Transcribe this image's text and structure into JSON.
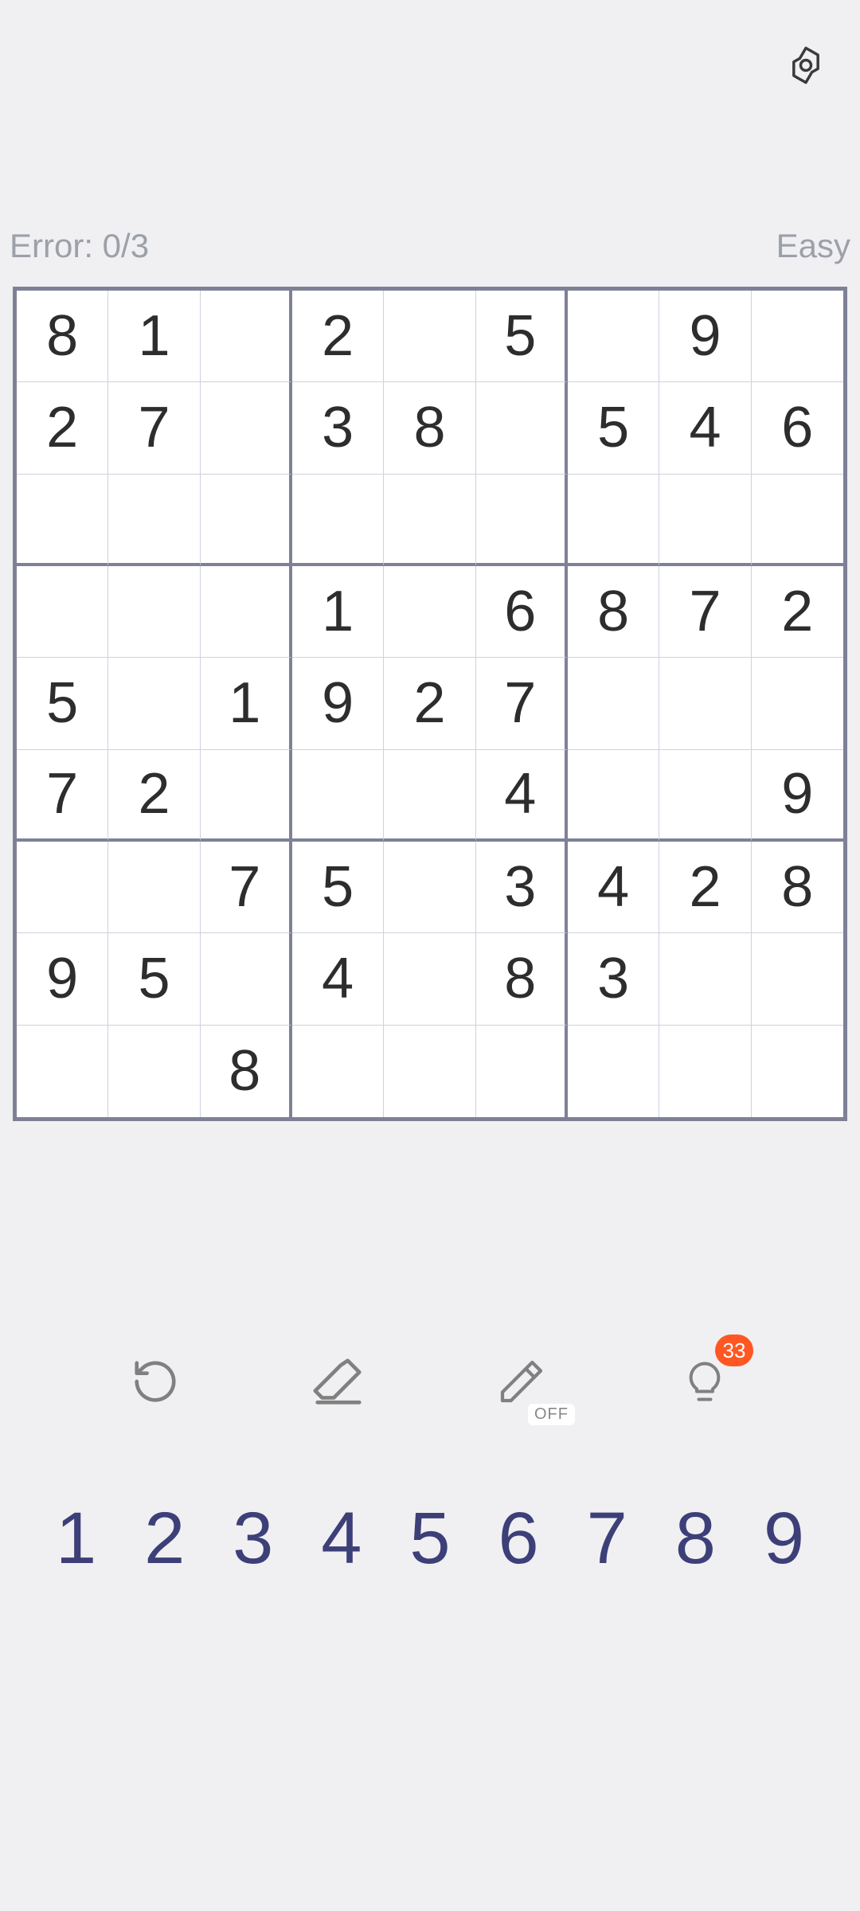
{
  "header": {
    "settings_icon": "settings"
  },
  "info": {
    "error_label": "Error: 0/3",
    "difficulty": "Easy"
  },
  "board": [
    [
      "8",
      "1",
      "",
      "2",
      "",
      "5",
      "",
      "9",
      ""
    ],
    [
      "2",
      "7",
      "",
      "3",
      "8",
      "",
      "5",
      "4",
      "6"
    ],
    [
      "",
      "",
      "",
      "",
      "",
      "",
      "",
      "",
      ""
    ],
    [
      "",
      "",
      "",
      "1",
      "",
      "6",
      "8",
      "7",
      "2"
    ],
    [
      "5",
      "",
      "1",
      "9",
      "2",
      "7",
      "",
      "",
      ""
    ],
    [
      "7",
      "2",
      "",
      "",
      "",
      "4",
      "",
      "",
      "9"
    ],
    [
      "",
      "",
      "7",
      "5",
      "",
      "3",
      "4",
      "2",
      "8"
    ],
    [
      "9",
      "5",
      "",
      "4",
      "",
      "8",
      "3",
      "",
      ""
    ],
    [
      "",
      "",
      "8",
      "",
      "",
      "",
      "",
      "",
      ""
    ]
  ],
  "tools": {
    "undo": "undo",
    "erase": "erase",
    "pencil": "pencil",
    "pencil_state": "OFF",
    "hint": "hint",
    "hint_count": "33"
  },
  "numbers": [
    "1",
    "2",
    "3",
    "4",
    "5",
    "6",
    "7",
    "8",
    "9"
  ]
}
